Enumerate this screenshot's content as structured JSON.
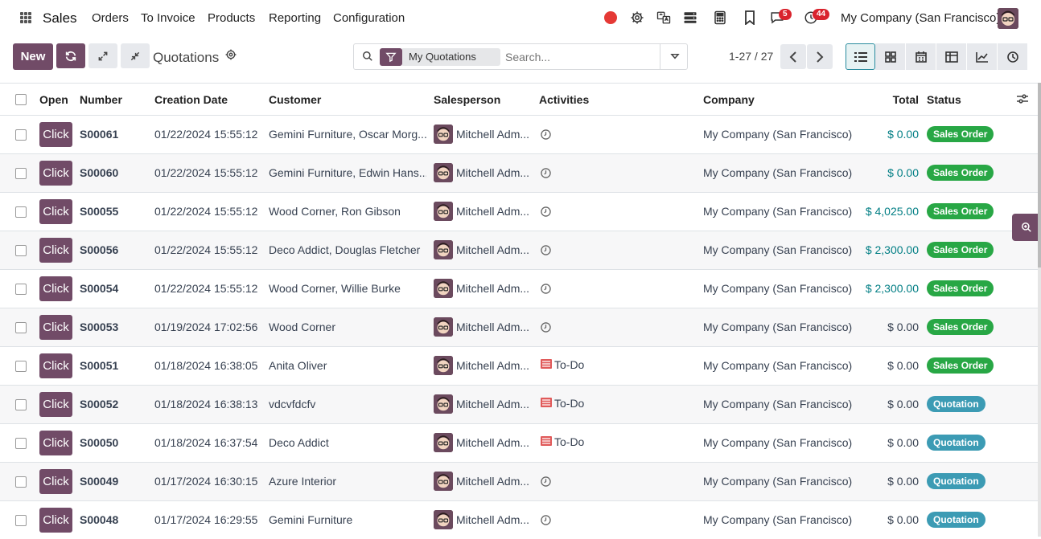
{
  "app": {
    "title": "Sales"
  },
  "nav": [
    "Orders",
    "To Invoice",
    "Products",
    "Reporting",
    "Configuration"
  ],
  "systray": {
    "messages_count": "5",
    "activities_count": "44",
    "company": "My Company (San Francisco)",
    "record_color": "#e53935"
  },
  "control": {
    "new_label": "New",
    "title": "Quotations",
    "facet": "My Quotations",
    "search_placeholder": "Search...",
    "pager": "1-27 / 27"
  },
  "columns": {
    "open": "Open",
    "number": "Number",
    "creation_date": "Creation Date",
    "customer": "Customer",
    "salesperson": "Salesperson",
    "activities": "Activities",
    "company": "Company",
    "total": "Total",
    "status": "Status"
  },
  "colors": {
    "brand": "#714b67",
    "link_total": "#017e84",
    "sales_order": "#28a745",
    "quotation": "#3c9bb4"
  },
  "rows": [
    {
      "open": "Click",
      "number": "S00061",
      "date": "01/22/2024 15:55:12",
      "customer": "Gemini Furniture, Oscar Morg...",
      "salesperson": "Mitchell Adm...",
      "activity": "clock",
      "activity_label": "",
      "company": "My Company (San Francisco)",
      "total": "$ 0.00",
      "total_highlight": true,
      "status": "Sales Order"
    },
    {
      "open": "Click",
      "number": "S00060",
      "date": "01/22/2024 15:55:12",
      "customer": "Gemini Furniture, Edwin Hans...",
      "salesperson": "Mitchell Adm...",
      "activity": "clock",
      "activity_label": "",
      "company": "My Company (San Francisco)",
      "total": "$ 0.00",
      "total_highlight": true,
      "status": "Sales Order"
    },
    {
      "open": "Click",
      "number": "S00055",
      "date": "01/22/2024 15:55:12",
      "customer": "Wood Corner, Ron Gibson",
      "salesperson": "Mitchell Adm...",
      "activity": "clock",
      "activity_label": "",
      "company": "My Company (San Francisco)",
      "total": "$ 4,025.00",
      "total_highlight": true,
      "status": "Sales Order"
    },
    {
      "open": "Click",
      "number": "S00056",
      "date": "01/22/2024 15:55:12",
      "customer": "Deco Addict, Douglas Fletcher",
      "salesperson": "Mitchell Adm...",
      "activity": "clock",
      "activity_label": "",
      "company": "My Company (San Francisco)",
      "total": "$ 2,300.00",
      "total_highlight": true,
      "status": "Sales Order"
    },
    {
      "open": "Click",
      "number": "S00054",
      "date": "01/22/2024 15:55:12",
      "customer": "Wood Corner, Willie Burke",
      "salesperson": "Mitchell Adm...",
      "activity": "clock",
      "activity_label": "",
      "company": "My Company (San Francisco)",
      "total": "$ 2,300.00",
      "total_highlight": true,
      "status": "Sales Order"
    },
    {
      "open": "Click",
      "number": "S00053",
      "date": "01/19/2024 17:02:56",
      "customer": "Wood Corner",
      "salesperson": "Mitchell Adm...",
      "activity": "clock",
      "activity_label": "",
      "company": "My Company (San Francisco)",
      "total": "$ 0.00",
      "total_highlight": false,
      "status": "Sales Order"
    },
    {
      "open": "Click",
      "number": "S00051",
      "date": "01/18/2024 16:38:05",
      "customer": "Anita Oliver",
      "salesperson": "Mitchell Adm...",
      "activity": "todo",
      "activity_label": "To-Do",
      "company": "My Company (San Francisco)",
      "total": "$ 0.00",
      "total_highlight": false,
      "status": "Sales Order"
    },
    {
      "open": "Click",
      "number": "S00052",
      "date": "01/18/2024 16:38:13",
      "customer": "vdcvfdcfv",
      "salesperson": "Mitchell Adm...",
      "activity": "todo",
      "activity_label": "To-Do",
      "company": "My Company (San Francisco)",
      "total": "$ 0.00",
      "total_highlight": false,
      "status": "Quotation"
    },
    {
      "open": "Click",
      "number": "S00050",
      "date": "01/18/2024 16:37:54",
      "customer": "Deco Addict",
      "salesperson": "Mitchell Adm...",
      "activity": "todo",
      "activity_label": "To-Do",
      "company": "My Company (San Francisco)",
      "total": "$ 0.00",
      "total_highlight": false,
      "status": "Quotation"
    },
    {
      "open": "Click",
      "number": "S00049",
      "date": "01/17/2024 16:30:15",
      "customer": "Azure Interior",
      "salesperson": "Mitchell Adm...",
      "activity": "clock",
      "activity_label": "",
      "company": "My Company (San Francisco)",
      "total": "$ 0.00",
      "total_highlight": false,
      "status": "Quotation"
    },
    {
      "open": "Click",
      "number": "S00048",
      "date": "01/17/2024 16:29:55",
      "customer": "Gemini Furniture",
      "salesperson": "Mitchell Adm...",
      "activity": "clock",
      "activity_label": "",
      "company": "My Company (San Francisco)",
      "total": "$ 0.00",
      "total_highlight": false,
      "status": "Quotation"
    }
  ]
}
